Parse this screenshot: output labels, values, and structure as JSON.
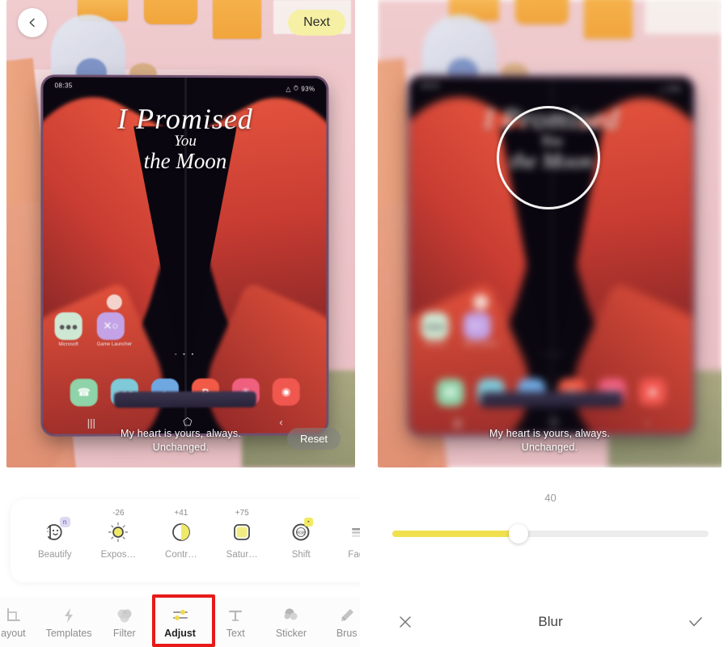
{
  "app": {
    "left_panel": {
      "header": {
        "back_icon": "chevron-left-icon",
        "next_label": "Next"
      },
      "photo": {
        "caption_line1": "My heart is yours, always.",
        "caption_line2": "Unchanged.",
        "reset_label": "Reset",
        "phone_screen": {
          "status_time": "08:35",
          "status_battery": "93%",
          "status_icons": "wifi-icon alarm-icon",
          "wallpaper_line1": "I Promised",
          "wallpaper_line2": "You",
          "wallpaper_line3": "the Moon",
          "page_dots": "▫ ▪ ▪",
          "apps": [
            {
              "label": "Microsoft",
              "glyph": "●●●",
              "color": "#cfe8d4"
            },
            {
              "label": "Game Launcher",
              "glyph": "✕○",
              "color": "#c3a3e6"
            }
          ],
          "dock": [
            {
              "label": "Phone",
              "glyph": "✆",
              "color": "#8fd3a8"
            },
            {
              "label": "Messages",
              "glyph": "●●●",
              "color": "#7fc9d8"
            },
            {
              "label": "Internet",
              "glyph": "◔",
              "color": "#6fa8e0"
            },
            {
              "label": "Samsung Pay",
              "glyph": "P",
              "color": "#f05a46"
            },
            {
              "label": "Gallery",
              "glyph": "✳",
              "color": "#ef5f7e"
            },
            {
              "label": "Camera",
              "glyph": "◉",
              "color": "#f0574f"
            }
          ],
          "nav_recents": "|||",
          "nav_home": "⬠",
          "nav_back": "‹"
        }
      },
      "adjust_tools": [
        {
          "label": "Beautify",
          "value": "",
          "icon": "beautify-face-icon",
          "badge": "n"
        },
        {
          "label": "Expos…",
          "value": "-26",
          "icon": "exposure-sun-icon",
          "badge": ""
        },
        {
          "label": "Contr…",
          "value": "+41",
          "icon": "contrast-circle-icon",
          "badge": ""
        },
        {
          "label": "Satur…",
          "value": "+75",
          "icon": "saturation-square-icon",
          "badge": ""
        },
        {
          "label": "Shift",
          "value": "",
          "icon": "rgb-shift-icon",
          "badge": "▪"
        },
        {
          "label": "Fade",
          "value": "",
          "icon": "fade-lines-icon",
          "badge": ""
        }
      ],
      "bottom_nav": [
        {
          "label": "ayout",
          "icon": "crop-layout-icon",
          "active": false
        },
        {
          "label": "Templates",
          "icon": "lightning-icon",
          "active": false
        },
        {
          "label": "Filter",
          "icon": "filter-drops-icon",
          "active": false
        },
        {
          "label": "Adjust",
          "icon": "sliders-icon",
          "active": true
        },
        {
          "label": "Text",
          "icon": "text-t-icon",
          "active": false
        },
        {
          "label": "Sticker",
          "icon": "sticker-cloud-icon",
          "active": false
        },
        {
          "label": "Brus",
          "icon": "brush-icon",
          "active": false
        }
      ],
      "highlight": {
        "target": "Adjust",
        "color": "#e81a1a"
      }
    },
    "right_panel": {
      "focus_ring": "blur-focus-ring",
      "slider": {
        "value": "40",
        "percent": 40,
        "fill_color": "#f0e04e"
      },
      "toolbar": {
        "cancel_icon": "close-x-icon",
        "title": "Blur",
        "confirm_icon": "check-icon"
      },
      "photo": {
        "caption_line1": "My heart is yours, always.",
        "caption_line2": "Unchanged."
      }
    }
  }
}
